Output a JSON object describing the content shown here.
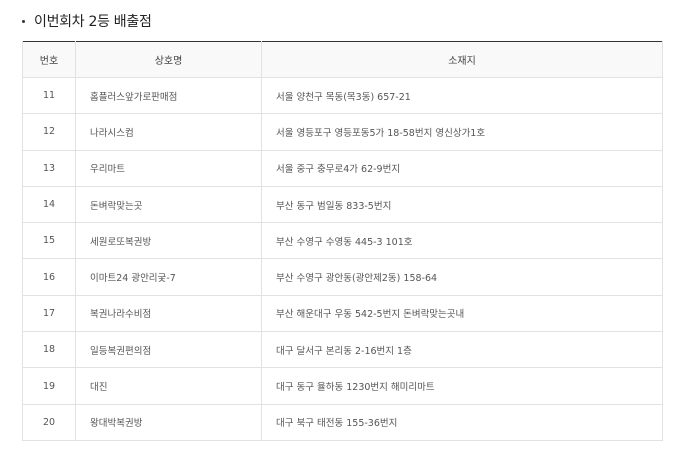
{
  "section": {
    "title": "이번회차 2등 배출점"
  },
  "table": {
    "headers": {
      "no": "번호",
      "name": "상호명",
      "address": "소재지"
    },
    "rows": [
      {
        "no": "11",
        "name": "홈플러스앞가로판매점",
        "address": "서울 양천구 목동(목3동) 657-21"
      },
      {
        "no": "12",
        "name": "나라시스컴",
        "address": "서울 영등포구 영등포동5가 18-58번지 영신상가1호"
      },
      {
        "no": "13",
        "name": "우리마트",
        "address": "서울 중구 충무로4가 62-9번지"
      },
      {
        "no": "14",
        "name": "돈벼락맞는곳",
        "address": "부산 동구 범일동 833-5번지"
      },
      {
        "no": "15",
        "name": "세원로또복권방",
        "address": "부산 수영구 수영동 445-3 101호"
      },
      {
        "no": "16",
        "name": "이마트24 광안리궂-7",
        "address": "부산 수영구 광안동(광안제2동) 158-64"
      },
      {
        "no": "17",
        "name": "복권나라수비점",
        "address": "부산 해운대구 우동 542-5번지 돈벼락맞는곳내"
      },
      {
        "no": "18",
        "name": "일등복권편의점",
        "address": "대구 달서구 본리동 2-16번지 1층"
      },
      {
        "no": "19",
        "name": "대진",
        "address": "대구 동구 율하동 1230번지 해미리마트"
      },
      {
        "no": "20",
        "name": "왕대박복권방",
        "address": "대구 북구 태전동 155-36번지"
      }
    ]
  }
}
